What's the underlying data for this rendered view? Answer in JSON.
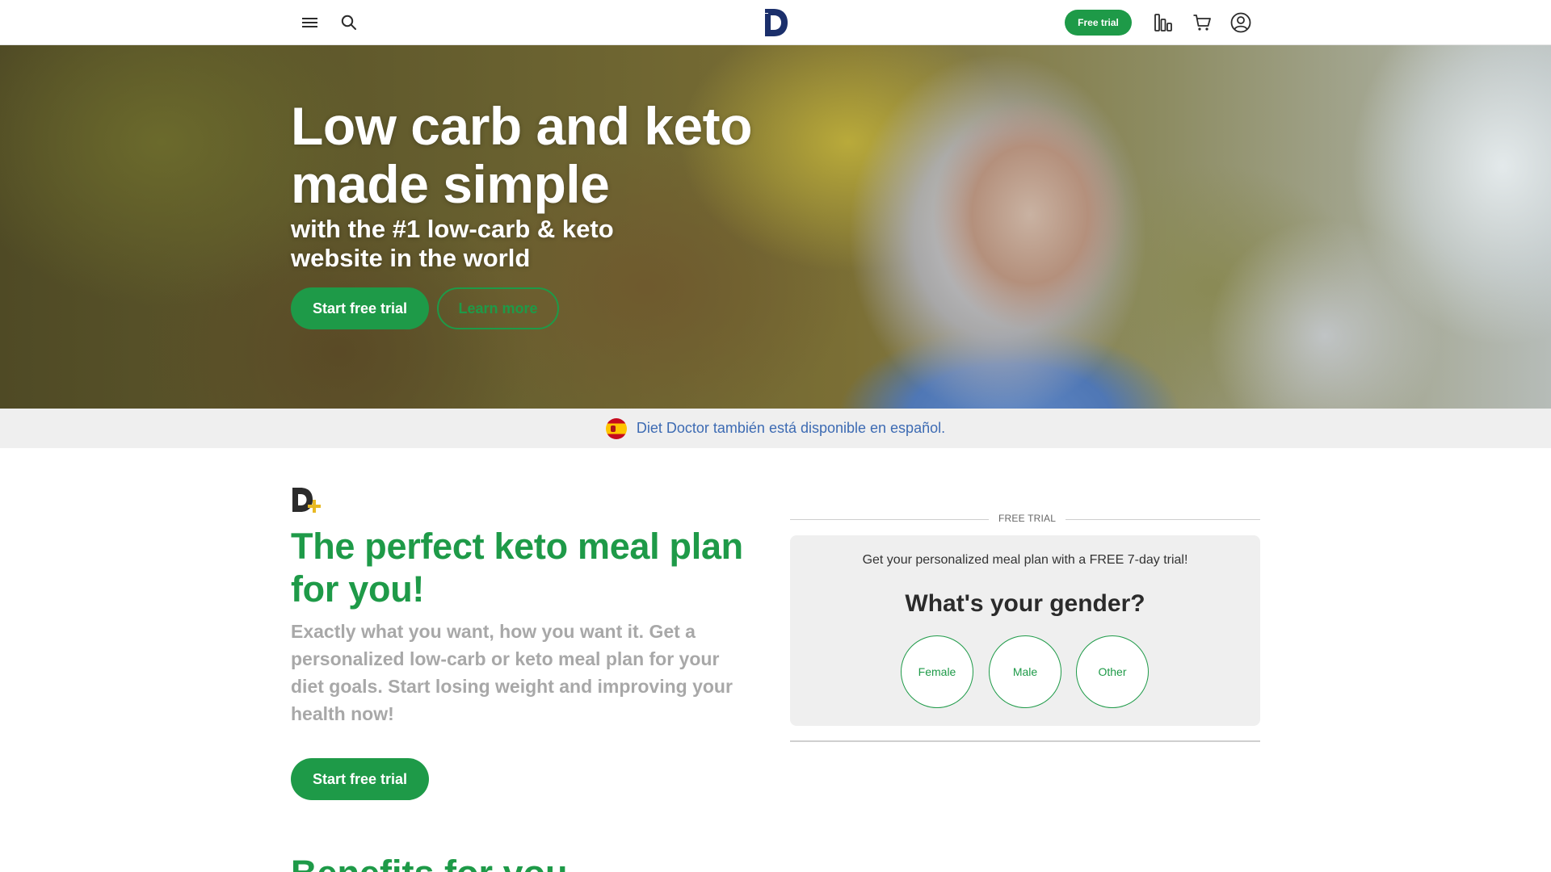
{
  "header": {
    "menu_icon": "hamburger-menu-icon",
    "search_icon": "search-icon",
    "logo_icon": "diet-doctor-logo",
    "free_trial_label": "Free trial",
    "stats_icon": "bar-chart-icon",
    "cart_icon": "shopping-cart-icon",
    "account_icon": "user-account-icon"
  },
  "hero": {
    "title": "Low carb and keto made simple",
    "subtitle": "with the #1 low-carb & keto website in the world",
    "start_button": "Start free trial",
    "learn_button": "Learn more"
  },
  "language_banner": {
    "flag_icon": "spain-flag-icon",
    "text": "Diet Doctor también está disponible en español."
  },
  "meal_plan": {
    "logo_icon": "dd-plus-logo",
    "title": "The perfect keto meal plan for you!",
    "description": "Exactly what you want, how you want it. Get a personalized low-carb or keto meal plan for your diet goals. Start losing weight and improving your health now!",
    "start_button": "Start free trial"
  },
  "free_trial_card": {
    "section_label": "FREE TRIAL",
    "promo_text": "Get your personalized meal plan with a FREE 7-day trial!",
    "question": "What's your gender?",
    "options": [
      "Female",
      "Male",
      "Other"
    ]
  },
  "benefits": {
    "title": "Benefits for you"
  },
  "colors": {
    "brand_green": "#1e9a48",
    "link_blue": "#3d6bb3",
    "logo_navy": "#1b2f6b",
    "banner_bg": "#efefef"
  }
}
